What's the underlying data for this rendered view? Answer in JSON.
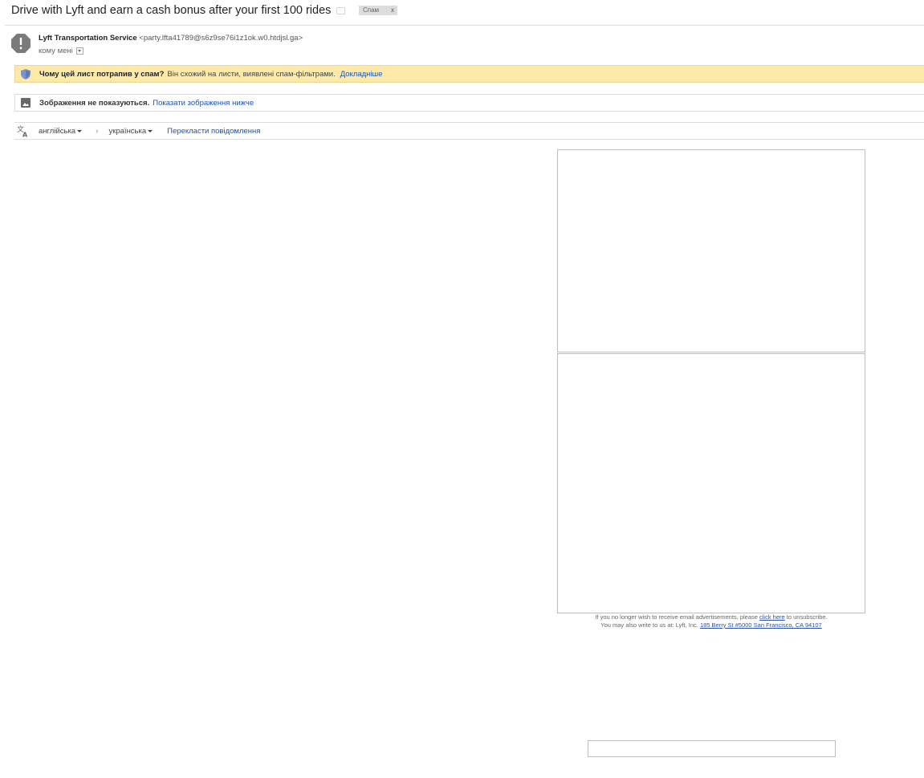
{
  "subject": {
    "title": "Drive with Lyft and earn a cash bonus after your first 100 rides",
    "label": "Спам",
    "label_remove": "x"
  },
  "sender": {
    "name": "Lyft Transportation Service",
    "email": "<party.lfta41789@s6z9se76i1z1ok.w0.htdjsl.ga>",
    "to": "кому мені"
  },
  "spam_banner": {
    "question": "Чому цей лист потрапив у спам?",
    "description": "Він схожий на листи, виявлені спам-фільтрами.",
    "link": "Докладніше"
  },
  "images_banner": {
    "text": "Зображення не показуються.",
    "link": "Показати зображення нижче"
  },
  "translate": {
    "from_lang": "англійська",
    "arrow": "›",
    "to_lang": "українська",
    "action": "Перекласти повідомлення"
  },
  "message": {
    "footer_line1_before": "If you no longer wish to receive email advertisements, please",
    "footer_link": "click here",
    "footer_line1_after": "to unsubscribe.",
    "footer_line2_before": "You may also write to us at: Lyft, Inc.",
    "footer_address": "185 Berry St #5000 San Francisco, CA 94107"
  },
  "colors": {
    "spam_banner_bg": "#fdeaa8",
    "link": "#1a52b4",
    "label_chip_bg": "#dddddd"
  }
}
